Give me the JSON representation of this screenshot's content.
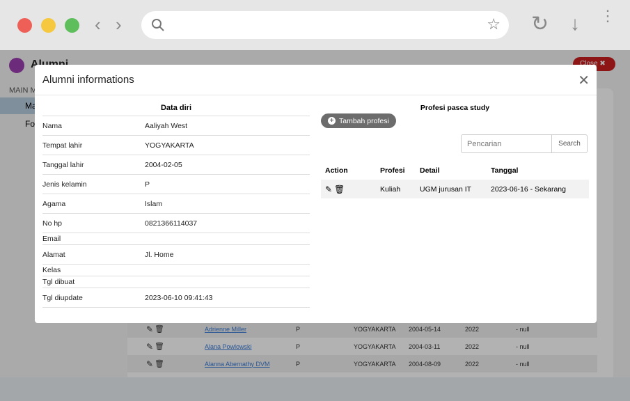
{
  "browser": {
    "icons": [
      "back-icon",
      "forward-icon",
      "search-icon",
      "star-icon",
      "reload-icon",
      "download-icon",
      "menu-icon"
    ],
    "colors": {
      "close": "#ee5f57",
      "min": "#f5c840",
      "max": "#5fbe5c"
    }
  },
  "app": {
    "title": "Alumni",
    "close_label": "Close",
    "sidebar": {
      "section": "MAIN M",
      "items": [
        {
          "label": "Ma"
        },
        {
          "label": "Fo"
        }
      ]
    },
    "rows": [
      {
        "name": "Adrienne Miller",
        "gender": "P",
        "birthplace": "YOGYAKARTA",
        "birthdate": "2004-05-14",
        "year": "2022",
        "profession": "- null"
      },
      {
        "name": "Alana Powlowski",
        "gender": "P",
        "birthplace": "YOGYAKARTA",
        "birthdate": "2004-03-11",
        "year": "2022",
        "profession": "- null"
      },
      {
        "name": "Alanna Abernathy DVM",
        "gender": "P",
        "birthplace": "YOGYAKARTA",
        "birthdate": "2004-08-09",
        "year": "2022",
        "profession": "- null"
      }
    ]
  },
  "modal": {
    "title": "Alumni informations",
    "data_diri": {
      "heading": "Data diri",
      "fields": [
        {
          "label": "Nama",
          "value": "Aaliyah West"
        },
        {
          "label": "Tempat lahir",
          "value": "YOGYAKARTA"
        },
        {
          "label": "Tanggal lahir",
          "value": "2004-02-05"
        },
        {
          "label": "Jenis kelamin",
          "value": "P"
        },
        {
          "label": "Agama",
          "value": "Islam"
        },
        {
          "label": "No hp",
          "value": "0821366114037"
        },
        {
          "label": "Email",
          "value": ""
        },
        {
          "label": "Alamat",
          "value": "Jl. Home"
        },
        {
          "label": "Kelas",
          "value": ""
        },
        {
          "label": "Tgl dibuat",
          "value": ""
        },
        {
          "label": "Tgl diupdate",
          "value": "2023-06-10 09:41:43"
        }
      ]
    },
    "profesi": {
      "heading": "Profesi pasca study",
      "add_label": "Tambah profesi",
      "search_placeholder": "Pencarian",
      "search_label": "Search",
      "headers": [
        "Action",
        "Profesi",
        "Detail",
        "Tanggal"
      ],
      "rows": [
        {
          "profesi": "Kuliah",
          "detail": "UGM jurusan IT",
          "tanggal": "2023-06-16 - Sekarang"
        }
      ]
    }
  }
}
